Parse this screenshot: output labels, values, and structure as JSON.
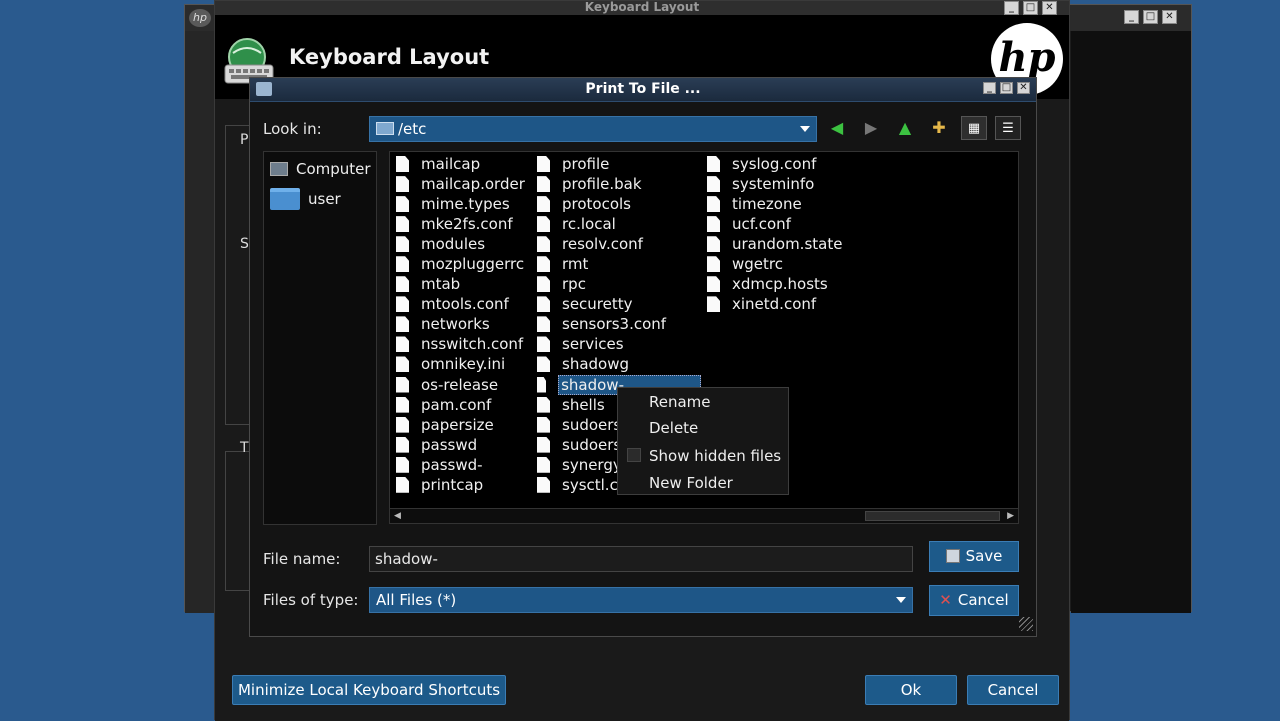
{
  "window": {
    "title": "Keyboard Layout",
    "heading": "Keyboard Layout",
    "brand_logo_text": "hp",
    "left_panel_letters": [
      "P",
      "S",
      "T"
    ],
    "footer": {
      "minimize_shortcuts_label": "Minimize Local Keyboard Shortcuts",
      "ok_label": "Ok",
      "cancel_label": "Cancel"
    }
  },
  "dialog": {
    "title": "Print To File ...",
    "look_in_label": "Look in:",
    "look_in_value": "/etc",
    "toolbar_icons": [
      "back-arrow-icon",
      "forward-arrow-icon",
      "parent-dir-icon",
      "new-folder-icon",
      "icon-view-icon",
      "detail-view-icon"
    ],
    "places": [
      {
        "label": "Computer",
        "icon": "computer-icon"
      },
      {
        "label": "user",
        "icon": "folder-icon"
      }
    ],
    "files": {
      "col1": [
        "mailcap",
        "mailcap.order",
        "mime.types",
        "mke2fs.conf",
        "modules",
        "mozpluggerrc",
        "mtab",
        "mtools.conf",
        "networks",
        "nsswitch.conf",
        "omnikey.ini",
        "os-release",
        "pam.conf",
        "papersize",
        "passwd",
        "passwd-",
        "printcap"
      ],
      "col2": [
        "profile",
        "profile.bak",
        "protocols",
        "rc.local",
        "resolv.conf",
        "rmt",
        "rpc",
        "securetty",
        "sensors3.conf",
        "services",
        "shadowg",
        "shadow-",
        "shells",
        "sudoers",
        "sudoers",
        "synergy",
        "sysctl.c"
      ],
      "col3": [
        "syslog.conf",
        "systeminfo",
        "timezone",
        "ucf.conf",
        "urandom.state",
        "wgetrc",
        "xdmcp.hosts",
        "xinetd.conf"
      ],
      "selected": "shadow-"
    },
    "context_menu": {
      "rename": "Rename",
      "delete": "Delete",
      "show_hidden": "Show hidden files",
      "new_folder": "New Folder"
    },
    "file_name_label": "File name:",
    "file_name_value": "shadow-",
    "files_of_type_label": "Files of type:",
    "files_of_type_value": "All Files (*)",
    "save_label": "Save",
    "cancel_label": "Cancel"
  }
}
